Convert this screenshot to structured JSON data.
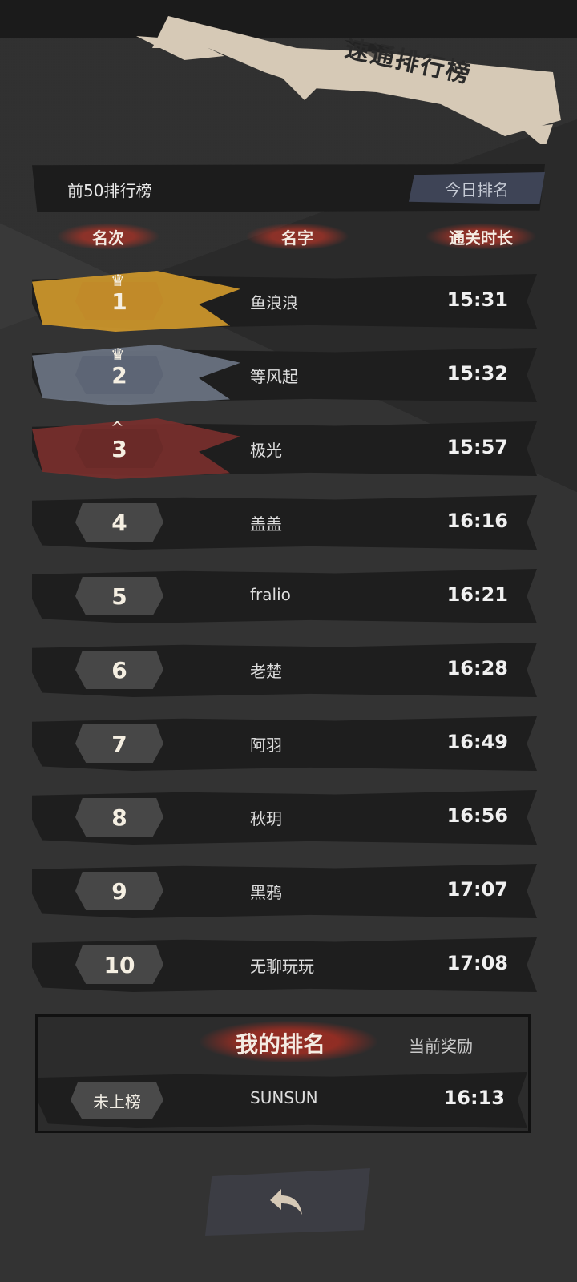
{
  "title": "速通排行榜",
  "header": {
    "label": "前50排行榜",
    "today_button": "今日排名"
  },
  "columns": {
    "rank": "名次",
    "name": "名字",
    "time": "通关时长"
  },
  "rows": [
    {
      "rank": "1",
      "name": "鱼浪浪",
      "time": "15:31"
    },
    {
      "rank": "2",
      "name": "等风起",
      "time": "15:32"
    },
    {
      "rank": "3",
      "name": "极光",
      "time": "15:57"
    },
    {
      "rank": "4",
      "name": "盖盖",
      "time": "16:16"
    },
    {
      "rank": "5",
      "name": "fralio",
      "time": "16:21"
    },
    {
      "rank": "6",
      "name": "老楚",
      "time": "16:28"
    },
    {
      "rank": "7",
      "name": "阿羽",
      "time": "16:49"
    },
    {
      "rank": "8",
      "name": "秋玥",
      "time": "16:56"
    },
    {
      "rank": "9",
      "name": "黑鸦",
      "time": "17:07"
    },
    {
      "rank": "10",
      "name": "无聊玩玩",
      "time": "17:08"
    }
  ],
  "my_rank": {
    "title": "我的排名",
    "reward_label": "当前奖励",
    "rank": "未上榜",
    "name": "SUNSUN",
    "time": "16:13"
  },
  "colors": {
    "gold": "#d39a2b",
    "silver": "#6d7685",
    "bronze": "#7a2f2c",
    "panel": "#1e1e1e",
    "accent_red": "#963228"
  },
  "icons": {
    "back": "back-arrow-icon",
    "crown": "crown-icon"
  }
}
